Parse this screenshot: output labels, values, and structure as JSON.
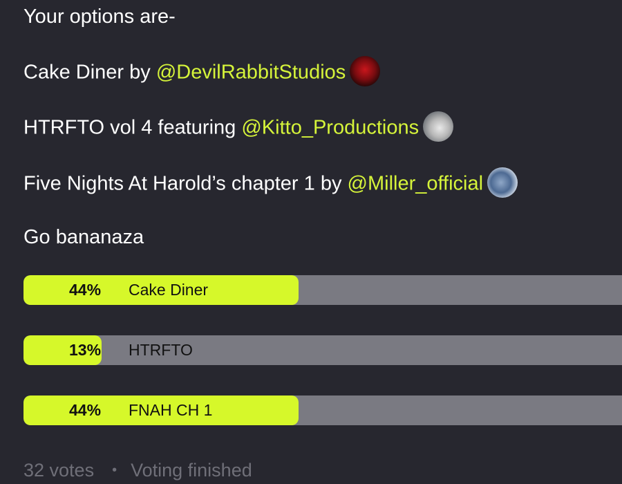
{
  "post": {
    "intro": "Your options are-",
    "lines": [
      {
        "text": "Cake Diner by ",
        "mention": "@DevilRabbitStudios",
        "avatar_icon": "devil-avatar"
      },
      {
        "text": "HTRFTO vol 4 featuring ",
        "mention": "@Kitto_Productions",
        "avatar_icon": "cat-avatar"
      },
      {
        "text": "Five Nights At Harold’s chapter 1 by ",
        "mention": "@Miller_official",
        "avatar_icon": "fish-avatar"
      }
    ],
    "closing": "Go bananaza"
  },
  "poll": {
    "options": [
      {
        "percent_label": "44%",
        "label": "Cake Diner",
        "fraction": 0.46
      },
      {
        "percent_label": "13%",
        "label": "HTRFTO",
        "fraction": 0.13
      },
      {
        "percent_label": "44%",
        "label": "FNAH CH 1",
        "fraction": 0.46
      }
    ],
    "votes": "32 votes",
    "separator": "•",
    "status": "Voting finished"
  },
  "colors": {
    "background": "#27272f",
    "mention": "#d6f43a",
    "bar_fill": "#d6f82a",
    "bar_track": "#7a7a82",
    "footer_text": "#6f6f78"
  }
}
